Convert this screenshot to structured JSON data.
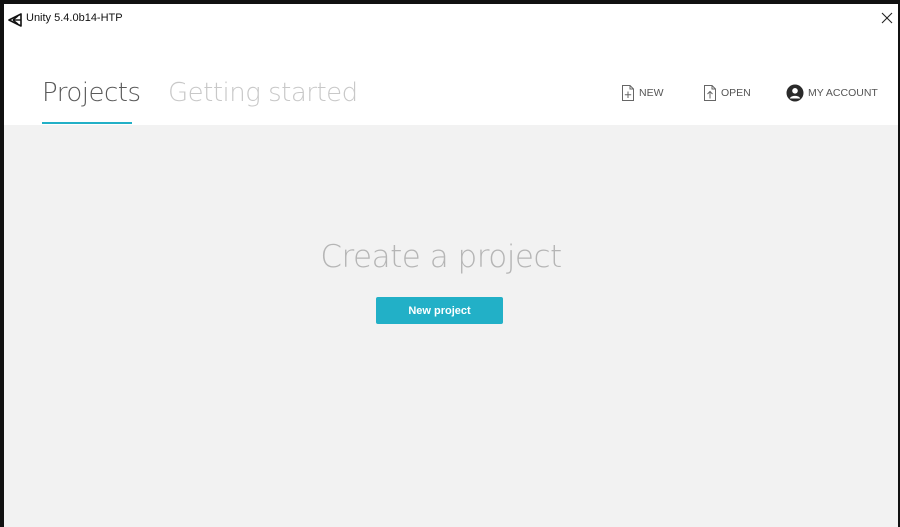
{
  "window": {
    "title": "Unity 5.4.0b14-HTP"
  },
  "header": {
    "tabs": [
      {
        "label": "Projects",
        "active": true
      },
      {
        "label": "Getting started",
        "active": false
      }
    ],
    "actions": {
      "new_label": "NEW",
      "open_label": "OPEN",
      "account_label": "MY ACCOUNT"
    }
  },
  "main": {
    "heading": "Create a project",
    "new_project_label": "New project"
  },
  "icons": {
    "app": "unity-logo-icon",
    "close": "close-icon",
    "new": "new-file-icon",
    "open": "open-file-icon",
    "account": "account-icon"
  },
  "colors": {
    "accent": "#22b0c7",
    "content_bg": "#f2f2f2",
    "active_tab": "#5a5a5a",
    "inactive_tab": "#c8c8c8"
  }
}
